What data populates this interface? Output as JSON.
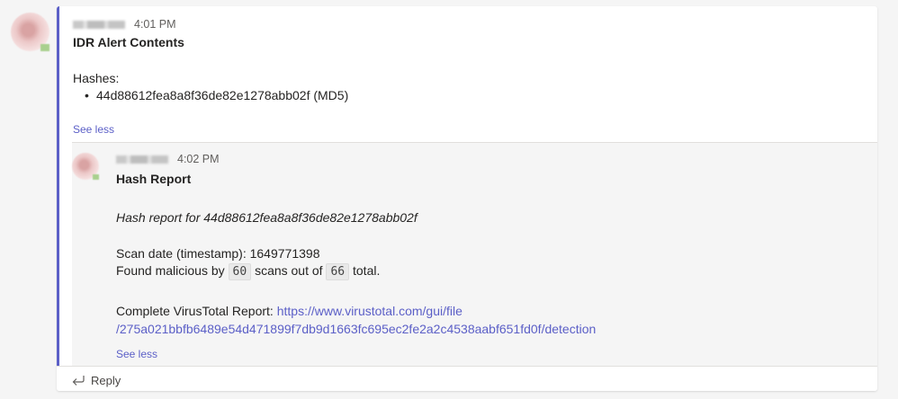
{
  "outer_message": {
    "time": "4:01 PM",
    "title": "IDR Alert Contents",
    "hashes_label": "Hashes:",
    "hash_item": "44d88612fea8a8f36de82e1278abb02f (MD5)",
    "see_less": "See less"
  },
  "reply_message": {
    "time": "4:02 PM",
    "title": "Hash Report",
    "report_heading": "Hash report for 44d88612fea8a8f36de82e1278abb02f",
    "scan_date": "Scan date (timestamp): 1649771398",
    "found_prefix": "Found malicious by",
    "malicious_count": "60",
    "found_middle": "scans out of",
    "total_count": "66",
    "found_suffix": "total.",
    "vt_label": "Complete VirusTotal Report:",
    "vt_link_line1": "https://www.virustotal.com/gui/file",
    "vt_link_line2": "/275a021bbfb6489e54d471899f7db9d1663fc695ec2fe2a2c4538aabf651fd0f/detection",
    "see_less": "See less"
  },
  "reply_button": {
    "label": "Reply",
    "icon": "reply-arrow-icon"
  },
  "colors": {
    "accent": "#5b5fc7",
    "link": "#5b5fc7"
  }
}
